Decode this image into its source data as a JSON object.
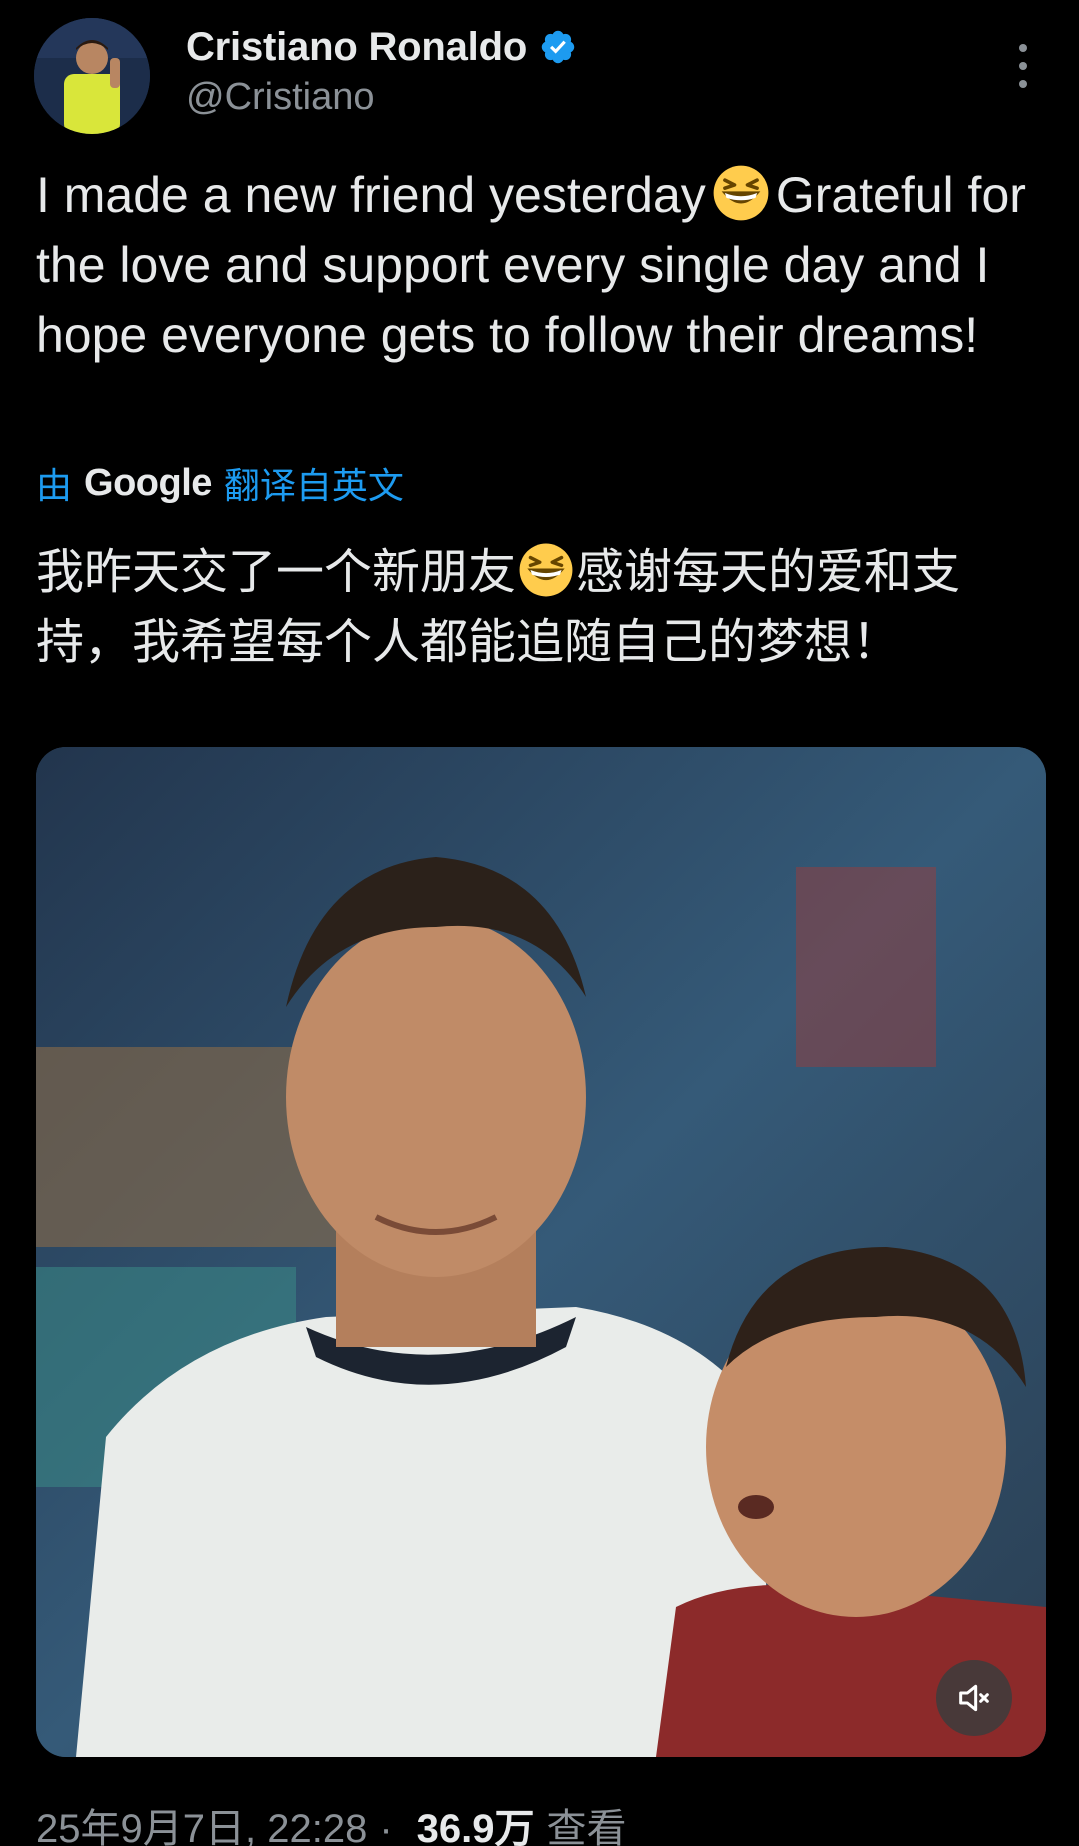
{
  "author": {
    "display_name": "Cristiano Ronaldo",
    "handle": "@Cristiano",
    "verified": true,
    "badge_color": "#1d9bf0"
  },
  "tweet": {
    "text_part1": "I made a new friend yesterday",
    "text_part2": "Grateful for the love and support every single day and I hope everyone gets to follow their dreams!",
    "emoji": "grinning-squinting-face"
  },
  "translation": {
    "prefix": "由",
    "provider": "Google",
    "suffix": "翻译自英文",
    "text_part1": "我昨天交了一个新朋友",
    "text_part2": "感谢每天的爱和支持，我希望每个人都能追随自己的梦想！"
  },
  "media": {
    "type": "video",
    "mute_icon": "speaker-muted-icon"
  },
  "meta": {
    "date": "25年9月7日",
    "time": "22:28",
    "separator": "·",
    "views_count": "36.9万",
    "views_label": "查看"
  },
  "colors": {
    "background": "#000000",
    "text_primary": "#e7e9ea",
    "text_secondary": "#8b9197",
    "link": "#1d9bf0"
  }
}
